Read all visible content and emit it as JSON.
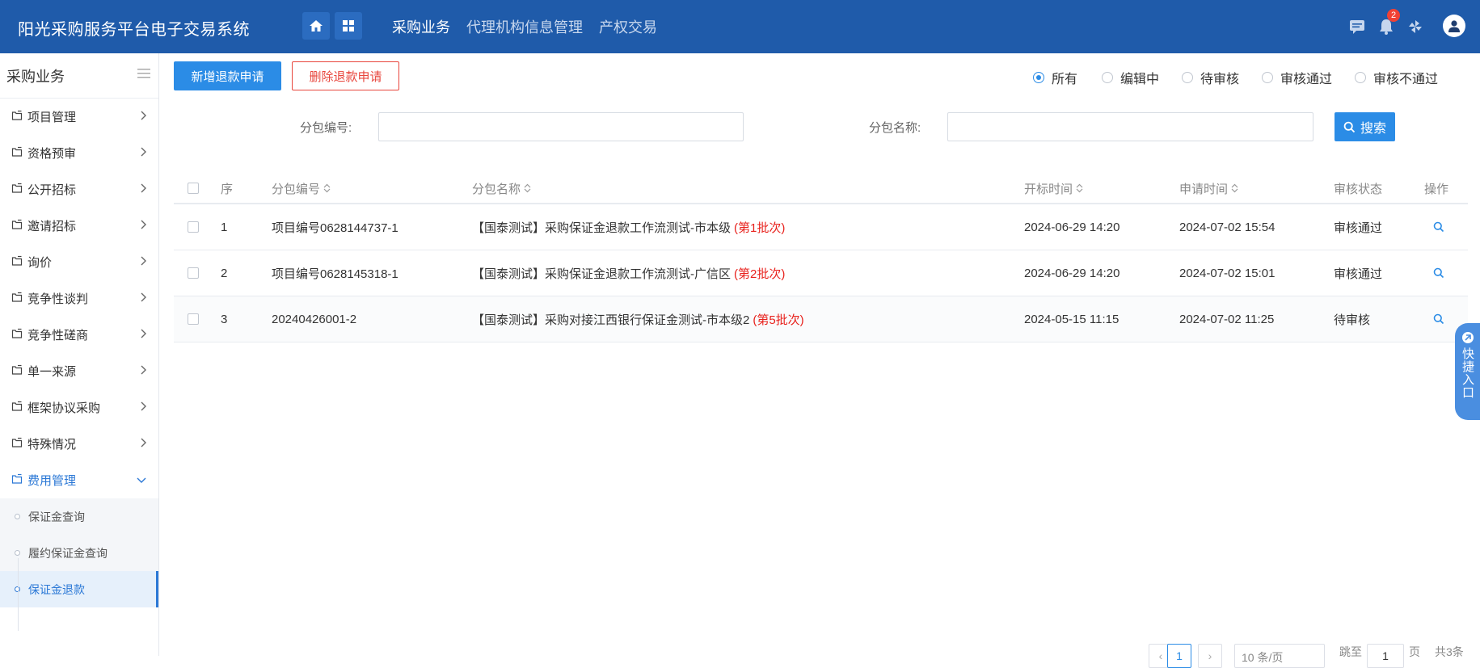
{
  "header": {
    "title": "阳光采购服务平台电子交易系统",
    "nav": [
      "采购业务",
      "代理机构信息管理",
      "产权交易"
    ],
    "notification_count": "2"
  },
  "sidebar": {
    "title": "采购业务",
    "items": [
      {
        "label": "项目管理"
      },
      {
        "label": "资格预审"
      },
      {
        "label": "公开招标"
      },
      {
        "label": "邀请招标"
      },
      {
        "label": "询价"
      },
      {
        "label": "竞争性谈判"
      },
      {
        "label": "竞争性磋商"
      },
      {
        "label": "单一来源"
      },
      {
        "label": "框架协议采购"
      },
      {
        "label": "特殊情况"
      },
      {
        "label": "费用管理"
      }
    ],
    "subitems": [
      {
        "label": "保证金查询"
      },
      {
        "label": "履约保证金查询"
      },
      {
        "label": "保证金退款"
      }
    ]
  },
  "toolbar": {
    "add_label": "新增退款申请",
    "delete_label": "删除退款申请"
  },
  "filter": {
    "options": [
      "所有",
      "编辑中",
      "待审核",
      "审核通过",
      "审核不通过"
    ],
    "selected": "所有"
  },
  "search": {
    "package_no_label": "分包编号:",
    "package_no_value": "",
    "package_name_label": "分包名称:",
    "package_name_value": "",
    "button_label": "搜索"
  },
  "table": {
    "columns": {
      "seq": "序",
      "package_no": "分包编号",
      "package_name": "分包名称",
      "open_time": "开标时间",
      "apply_time": "申请时间",
      "status": "审核状态",
      "action": "操作"
    },
    "rows": [
      {
        "seq": "1",
        "package_no": "项目编号0628144737-1",
        "package_name": "【国泰测试】采购保证金退款工作流测试-市本级",
        "batch": "(第1批次)",
        "open_time": "2024-06-29 14:20",
        "apply_time": "2024-07-02 15:54",
        "status": "审核通过"
      },
      {
        "seq": "2",
        "package_no": "项目编号0628145318-1",
        "package_name": "【国泰测试】采购保证金退款工作流测试-广信区",
        "batch": "(第2批次)",
        "open_time": "2024-06-29 14:20",
        "apply_time": "2024-07-02 15:01",
        "status": "审核通过"
      },
      {
        "seq": "3",
        "package_no": "20240426001-2",
        "package_name": "【国泰测试】采购对接江西银行保证金测试-市本级2",
        "batch": "(第5批次)",
        "open_time": "2024-05-15 11:15",
        "apply_time": "2024-07-02 11:25",
        "status": "待审核"
      }
    ]
  },
  "quick_entry": {
    "label": "快捷入口"
  },
  "pagination": {
    "current_page": "1",
    "page_size": "10 条/页",
    "jump_prefix": "跳至",
    "jump_value": "1",
    "jump_suffix": "页",
    "total": "共3条"
  },
  "colors": {
    "header_bg": "#1f5baa",
    "primary": "#2b8ce6",
    "danger": "#e8453c",
    "batch_red": "#e8211c"
  },
  "icons": {
    "home": "home-icon",
    "apps": "apps-grid-icon",
    "message": "message-icon",
    "bell": "bell-icon",
    "settings": "pinwheel-icon",
    "user": "user-avatar-icon",
    "menu": "hamburger-icon",
    "folder": "folder-icon",
    "chevron": "chevron-right-icon",
    "search": "search-icon",
    "sort": "sort-icon"
  }
}
